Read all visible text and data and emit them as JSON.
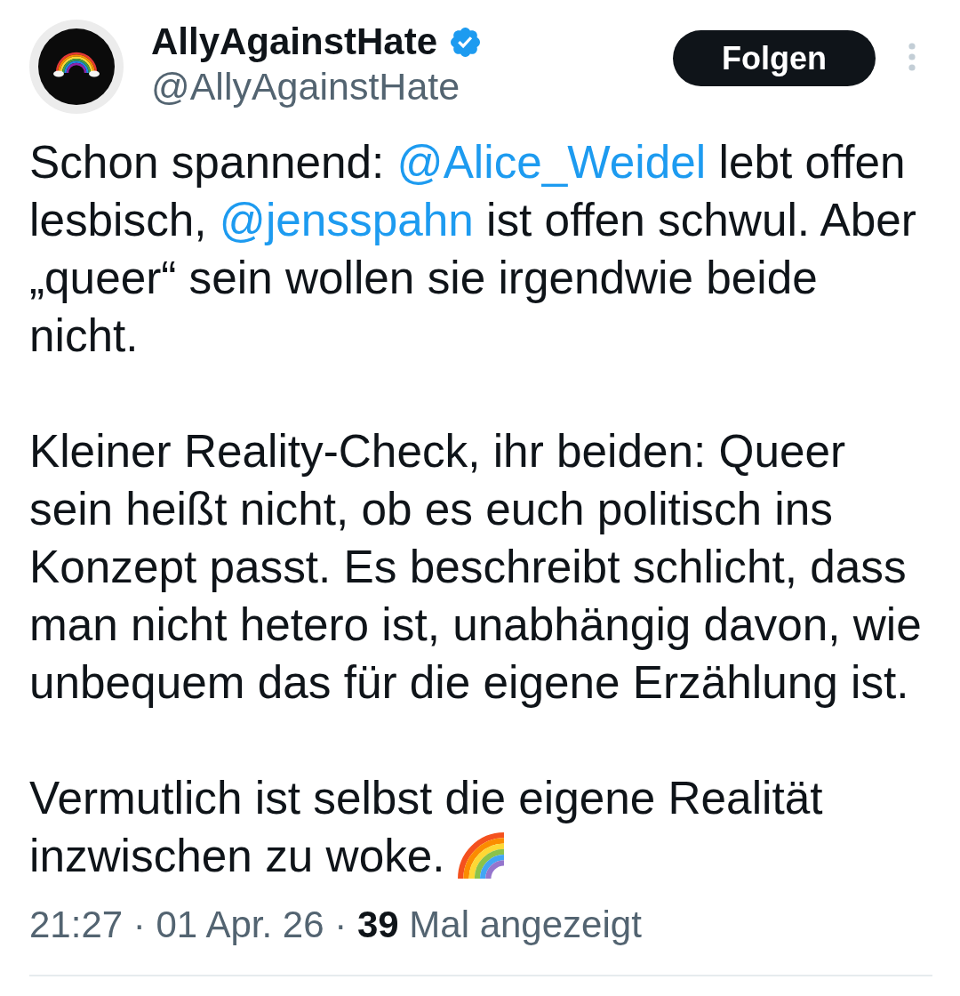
{
  "author": {
    "name": "AllyAgainstHate",
    "verified": true,
    "handle": "@AllyAgainstHate"
  },
  "follow_button": {
    "label": "Folgen"
  },
  "paragraphs": [
    {
      "segments": [
        {
          "kind": "text",
          "text": "Schon spannend: "
        },
        {
          "kind": "mention",
          "text": "@Alice_Weidel"
        },
        {
          "kind": "text",
          "text": " lebt offen lesbisch, "
        },
        {
          "kind": "mention",
          "text": "@jensspahn"
        },
        {
          "kind": "text",
          "text": " ist offen schwul. Aber „queer“ sein wollen sie irgendwie beide nicht."
        }
      ]
    },
    {
      "segments": [
        {
          "kind": "text",
          "text": "Kleiner Reality-Check, ihr beiden: Queer sein heißt nicht, ob es euch politisch ins Konzept passt. Es beschreibt schlicht, dass man nicht hetero ist, unabhängig davon, wie unbequem das für die eigene Erzählung ist."
        }
      ]
    },
    {
      "segments": [
        {
          "kind": "text",
          "text": "Vermutlich ist selbst die eigene Realität inzwischen zu woke. "
        }
      ]
    }
  ],
  "meta": "21:27 · 01 Apr. 26 · **39** Mal angezeigt"
}
